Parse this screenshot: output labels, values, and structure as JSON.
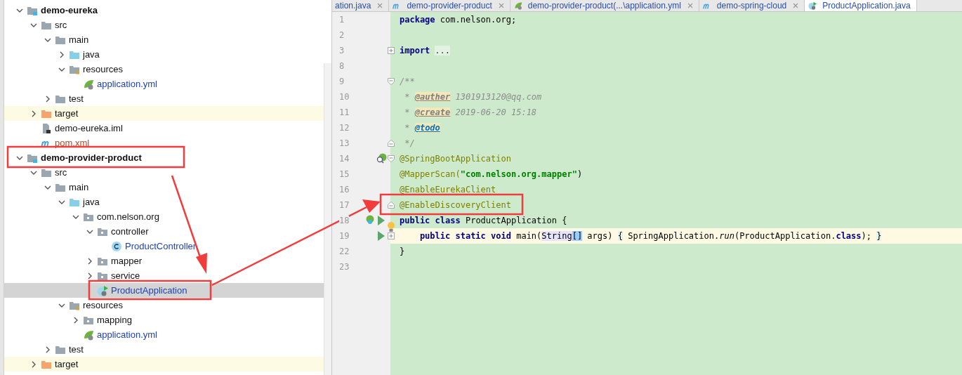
{
  "project_tree": [
    {
      "label": "demo-eureka",
      "kind": "module",
      "expanded": true,
      "selected": false,
      "children": [
        {
          "label": "src",
          "kind": "folder",
          "expanded": true,
          "selected": false,
          "children": [
            {
              "label": "main",
              "kind": "folder",
              "expanded": true,
              "selected": false,
              "children": [
                {
                  "label": "java",
                  "kind": "source-folder",
                  "expanded": false,
                  "selected": false
                },
                {
                  "label": "resources",
                  "kind": "resources-folder",
                  "expanded": true,
                  "selected": false,
                  "children": [
                    {
                      "label": "application.yml",
                      "kind": "spring-config",
                      "color": "#1f43b0",
                      "selected": false
                    }
                  ]
                }
              ]
            },
            {
              "label": "test",
              "kind": "folder",
              "expanded": false,
              "selected": false
            }
          ]
        },
        {
          "label": "target",
          "kind": "excluded-folder",
          "expanded": false,
          "selected": false
        },
        {
          "label": "demo-eureka.iml",
          "kind": "iml",
          "selected": false
        },
        {
          "label": "pom.xml",
          "kind": "maven",
          "color": "#b0492c",
          "selected": false
        }
      ]
    },
    {
      "label": "demo-provider-product",
      "kind": "module",
      "expanded": true,
      "selected": false,
      "children": [
        {
          "label": "src",
          "kind": "folder",
          "expanded": true,
          "selected": false,
          "children": [
            {
              "label": "main",
              "kind": "folder",
              "expanded": true,
              "selected": false,
              "children": [
                {
                  "label": "java",
                  "kind": "source-folder",
                  "expanded": true,
                  "selected": false,
                  "children": [
                    {
                      "label": "com.nelson.org",
                      "kind": "package",
                      "expanded": true,
                      "selected": false,
                      "children": [
                        {
                          "label": "controller",
                          "kind": "package",
                          "expanded": true,
                          "selected": false,
                          "children": [
                            {
                              "label": "ProductController",
                              "kind": "class",
                              "color": "#1f43b0",
                              "selected": false
                            }
                          ]
                        },
                        {
                          "label": "mapper",
                          "kind": "package",
                          "expanded": false,
                          "selected": false
                        },
                        {
                          "label": "service",
                          "kind": "package",
                          "expanded": false,
                          "selected": false
                        },
                        {
                          "label": "ProductApplication",
                          "kind": "spring-class",
                          "color": "#1f43b0",
                          "selected": true
                        }
                      ]
                    }
                  ]
                },
                {
                  "label": "resources",
                  "kind": "resources-folder",
                  "expanded": true,
                  "selected": false,
                  "children": [
                    {
                      "label": "mapping",
                      "kind": "package",
                      "expanded": false,
                      "selected": false
                    },
                    {
                      "label": "application.yml",
                      "kind": "spring-config",
                      "color": "#1f43b0",
                      "selected": false
                    }
                  ]
                }
              ]
            },
            {
              "label": "test",
              "kind": "folder",
              "expanded": false,
              "selected": false
            }
          ]
        },
        {
          "label": "target",
          "kind": "excluded-folder",
          "expanded": false,
          "selected": false
        }
      ]
    }
  ],
  "editor_tabs": [
    {
      "label": "ation.java",
      "kind": "java",
      "selected": false
    },
    {
      "label": "demo-provider-product",
      "kind": "maven",
      "selected": false
    },
    {
      "label": "demo-provider-product(...\\application.yml",
      "kind": "spring-config",
      "selected": false
    },
    {
      "label": "demo-spring-cloud",
      "kind": "maven",
      "selected": false
    },
    {
      "label": "ProductApplication.java",
      "kind": "spring-class",
      "selected": true
    }
  ],
  "code_lines": [
    {
      "number": "1",
      "current": false,
      "bulb": false,
      "tokens": [
        {
          "text": "package",
          "kind": "keyword"
        },
        {
          "text": " com.nelson.org;",
          "kind": "plain"
        }
      ]
    },
    {
      "number": "2",
      "current": false,
      "bulb": false
    },
    {
      "number": "3",
      "current": false,
      "bulb": false,
      "markers": [
        {
          "kind": "fold-expand"
        }
      ],
      "tokens": [
        {
          "text": "import",
          "kind": "keyword"
        },
        {
          "text": "...",
          "kind": "folded"
        }
      ]
    },
    {
      "number": "8",
      "current": false,
      "bulb": false
    },
    {
      "number": "9",
      "current": false,
      "bulb": false,
      "markers": [
        {
          "kind": "fold-start"
        }
      ],
      "tokens": [
        {
          "text": "/**",
          "kind": "comment"
        }
      ]
    },
    {
      "number": "10",
      "current": false,
      "bulb": false,
      "tokens": [
        {
          "text": " * ",
          "kind": "comment"
        },
        {
          "text": "@auther",
          "kind": "doc-tag"
        },
        {
          "text": " 1301913120@qq.com",
          "kind": "comment"
        }
      ]
    },
    {
      "number": "11",
      "current": false,
      "bulb": false,
      "tokens": [
        {
          "text": " * ",
          "kind": "comment"
        },
        {
          "text": "@create",
          "kind": "doc-tag"
        },
        {
          "text": " 2019-06-20 15:18",
          "kind": "comment"
        }
      ]
    },
    {
      "number": "12",
      "current": false,
      "bulb": false,
      "tokens": [
        {
          "text": " * ",
          "kind": "comment"
        },
        {
          "text": "@todo",
          "kind": "todo"
        }
      ]
    },
    {
      "number": "13",
      "current": false,
      "bulb": false,
      "markers": [
        {
          "kind": "fold-end"
        }
      ],
      "tokens": [
        {
          "text": " */",
          "kind": "comment"
        }
      ]
    },
    {
      "number": "14",
      "current": false,
      "bulb": false,
      "markers": [
        {
          "kind": "bean"
        },
        {
          "kind": "fold-start"
        }
      ],
      "tokens": [
        {
          "text": "@SpringBootApplication",
          "kind": "annotation"
        }
      ]
    },
    {
      "number": "15",
      "current": false,
      "bulb": false,
      "tokens": [
        {
          "text": "@MapperScan(",
          "kind": "annotation"
        },
        {
          "text": "\"com.nelson.org.mapper\"",
          "kind": "string"
        },
        {
          "text": ")",
          "kind": "plain"
        }
      ]
    },
    {
      "number": "16",
      "current": false,
      "bulb": false,
      "tokens": [
        {
          "text": "@EnableEurekaClient",
          "kind": "annotation"
        }
      ]
    },
    {
      "number": "17",
      "current": false,
      "bulb": false,
      "markers": [
        {
          "kind": "fold-end"
        }
      ],
      "tokens": [
        {
          "text": "@EnableDiscoveryClient",
          "kind": "annotation"
        }
      ]
    },
    {
      "number": "18",
      "current": false,
      "bulb": true,
      "markers": [
        {
          "kind": "run-bean"
        }
      ],
      "tokens": [
        {
          "text": "public class",
          "kind": "keyword"
        },
        {
          "text": " ProductApplication {",
          "kind": "plain"
        }
      ]
    },
    {
      "number": "19",
      "current": true,
      "bulb": false,
      "markers": [
        {
          "kind": "run"
        },
        {
          "kind": "fold-expand"
        }
      ],
      "tokens": [
        {
          "text": "    public static void",
          "kind": "keyword"
        },
        {
          "text": " main(",
          "kind": "plain"
        },
        {
          "text": "String",
          "kind": "param"
        },
        {
          "text": "[]",
          "kind": "bracket"
        },
        {
          "text": " args) ",
          "kind": "plain"
        },
        {
          "text": "{",
          "kind": "brace"
        },
        {
          "text": " SpringApplication.",
          "kind": "plain"
        },
        {
          "text": "run",
          "kind": "italic"
        },
        {
          "text": "(ProductApplication.",
          "kind": "plain"
        },
        {
          "text": "class",
          "kind": "keyword"
        },
        {
          "text": "); ",
          "kind": "plain"
        },
        {
          "text": "}",
          "kind": "brace"
        }
      ]
    },
    {
      "number": "22",
      "current": false,
      "bulb": false,
      "tokens": [
        {
          "text": "}",
          "kind": "plain"
        }
      ]
    },
    {
      "number": "23",
      "current": false,
      "bulb": false
    }
  ]
}
